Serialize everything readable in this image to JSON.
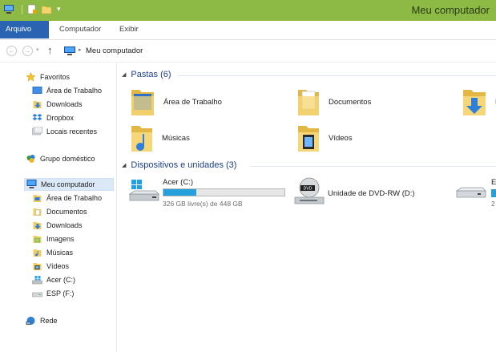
{
  "window": {
    "title": "Meu computador"
  },
  "ribbon": {
    "tabs": [
      "Arquivo",
      "Computador",
      "Exibir"
    ]
  },
  "address": {
    "path": "Meu computador"
  },
  "sidebar": {
    "favorites": {
      "label": "Favoritos",
      "items": [
        "Área de Trabalho",
        "Downloads",
        "Dropbox",
        "Locais recentes"
      ]
    },
    "homegroup": {
      "label": "Grupo doméstico"
    },
    "computer": {
      "label": "Meu computador",
      "items": [
        "Área de Trabalho",
        "Documentos",
        "Downloads",
        "Imagens",
        "Músicas",
        "Vídeos",
        "Acer (C:)",
        "ESP (F:)"
      ]
    },
    "network": {
      "label": "Rede"
    }
  },
  "folders": {
    "header": "Pastas (6)",
    "items": [
      "Área de Trabalho",
      "Documentos",
      "D",
      "Músicas",
      "Vídeos"
    ]
  },
  "devices": {
    "header": "Dispositivos e unidades (3)",
    "drive_c": {
      "label": "Acer (C:)",
      "free": "326 GB livre(s) de 448 GB",
      "used_fraction": 0.27
    },
    "dvd": {
      "label": "Unidade de DVD-RW (D:)"
    },
    "drive_e": {
      "label": "E",
      "free": "2"
    }
  },
  "colors": {
    "titlebar": "#8dba45",
    "file_tab": "#2b63b3",
    "group_header": "#1e3f8a",
    "capacity": "#26a0da"
  }
}
